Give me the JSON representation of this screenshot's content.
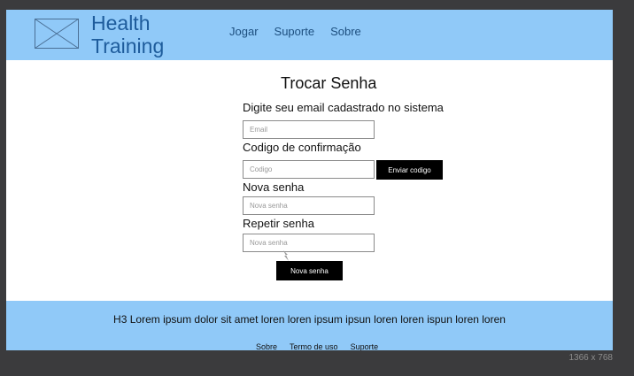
{
  "header": {
    "brand_line1": "Health",
    "brand_line2": "Training",
    "nav": [
      "Jogar",
      "Suporte",
      "Sobre"
    ]
  },
  "form": {
    "title": "Trocar Senha",
    "email_label": "Digite seu email cadastrado no sistema",
    "email_placeholder": "Email",
    "code_label": "Codigo de confirmação",
    "code_placeholder": "Codigo",
    "send_code_button": "Enviar codigo",
    "new_password_label": "Nova senha",
    "new_password_placeholder": "Nova senha",
    "repeat_password_label": "Repetir senha",
    "repeat_password_placeholder": "Nova senha",
    "submit_button": "Nova senha"
  },
  "footer": {
    "text": "H3 Lorem ipsum dolor sit amet loren loren ipsum ipsun loren loren ispun loren loren",
    "links": [
      "Sobre",
      "Termo de uso",
      "Suporte"
    ]
  },
  "canvas": {
    "resolution_label": "1366 x 768"
  },
  "colors": {
    "header_bg": "#90c9f8",
    "brand_text": "#1e5c9c",
    "button_bg": "#000000"
  }
}
